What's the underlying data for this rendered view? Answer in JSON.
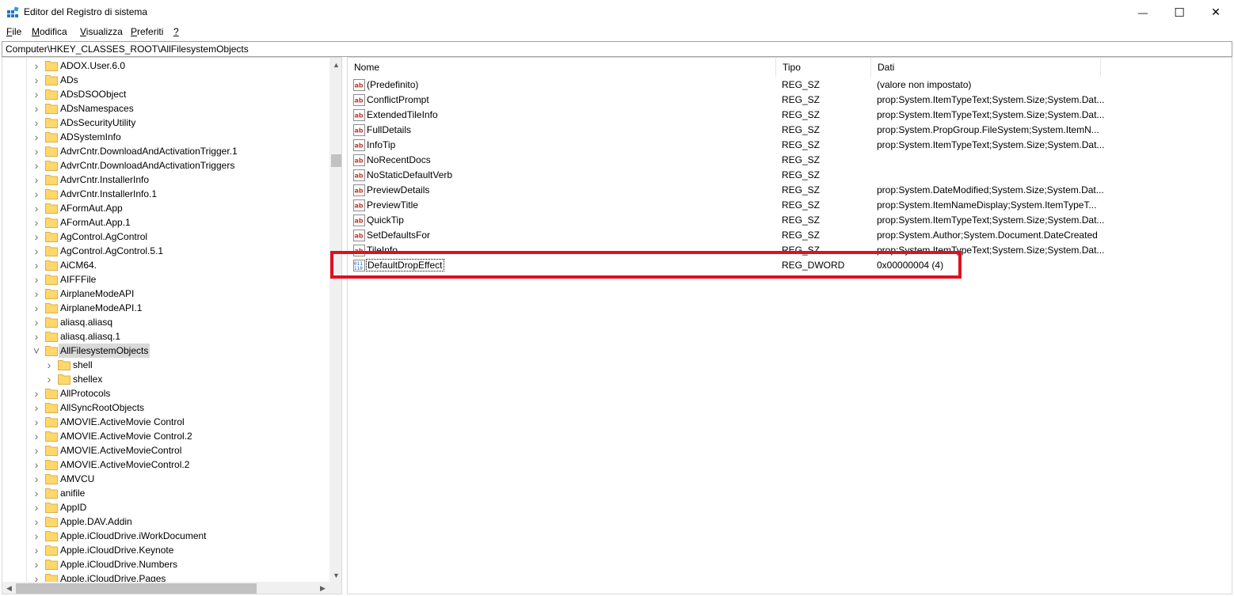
{
  "window": {
    "title": "Editor del Registro di sistema",
    "minimize_glyph": "—",
    "maximize_glyph": "☐",
    "close_glyph": "✕"
  },
  "menu": [
    {
      "label": "File",
      "underline_index": 0
    },
    {
      "label": "Modifica",
      "underline_index": 0
    },
    {
      "label": "Visualizza",
      "underline_index": 0
    },
    {
      "label": "Preferiti",
      "underline_index": 0
    },
    {
      "label": "?",
      "underline_index": 0
    }
  ],
  "address": "Computer\\HKEY_CLASSES_ROOT\\AllFilesystemObjects",
  "tree": {
    "items": [
      {
        "label": "ADOX.User.6.0",
        "level": 0,
        "expanded": false
      },
      {
        "label": "ADs",
        "level": 0,
        "expanded": false
      },
      {
        "label": "ADsDSOObject",
        "level": 0,
        "expanded": false
      },
      {
        "label": "ADsNamespaces",
        "level": 0,
        "expanded": false
      },
      {
        "label": "ADsSecurityUtility",
        "level": 0,
        "expanded": false
      },
      {
        "label": "ADSystemInfo",
        "level": 0,
        "expanded": false
      },
      {
        "label": "AdvrCntr.DownloadAndActivationTrigger.1",
        "level": 0,
        "expanded": false
      },
      {
        "label": "AdvrCntr.DownloadAndActivationTriggers",
        "level": 0,
        "expanded": false
      },
      {
        "label": "AdvrCntr.InstallerInfo",
        "level": 0,
        "expanded": false
      },
      {
        "label": "AdvrCntr.InstallerInfo.1",
        "level": 0,
        "expanded": false
      },
      {
        "label": "AFormAut.App",
        "level": 0,
        "expanded": false
      },
      {
        "label": "AFormAut.App.1",
        "level": 0,
        "expanded": false
      },
      {
        "label": "AgControl.AgControl",
        "level": 0,
        "expanded": false
      },
      {
        "label": "AgControl.AgControl.5.1",
        "level": 0,
        "expanded": false
      },
      {
        "label": "AiCM64.",
        "level": 0,
        "expanded": false
      },
      {
        "label": "AIFFFile",
        "level": 0,
        "expanded": false
      },
      {
        "label": "AirplaneModeAPI",
        "level": 0,
        "expanded": false
      },
      {
        "label": "AirplaneModeAPI.1",
        "level": 0,
        "expanded": false
      },
      {
        "label": "aliasq.aliasq",
        "level": 0,
        "expanded": false
      },
      {
        "label": "aliasq.aliasq.1",
        "level": 0,
        "expanded": false
      },
      {
        "label": "AllFilesystemObjects",
        "level": 0,
        "expanded": true,
        "selected": true
      },
      {
        "label": "shell",
        "level": 1,
        "expanded": false
      },
      {
        "label": "shellex",
        "level": 1,
        "expanded": false
      },
      {
        "label": "AllProtocols",
        "level": 0,
        "expanded": false
      },
      {
        "label": "AllSyncRootObjects",
        "level": 0,
        "expanded": false
      },
      {
        "label": "AMOVIE.ActiveMovie Control",
        "level": 0,
        "expanded": false
      },
      {
        "label": "AMOVIE.ActiveMovie Control.2",
        "level": 0,
        "expanded": false
      },
      {
        "label": "AMOVIE.ActiveMovieControl",
        "level": 0,
        "expanded": false
      },
      {
        "label": "AMOVIE.ActiveMovieControl.2",
        "level": 0,
        "expanded": false
      },
      {
        "label": "AMVCU",
        "level": 0,
        "expanded": false
      },
      {
        "label": "anifile",
        "level": 0,
        "expanded": false
      },
      {
        "label": "AppID",
        "level": 0,
        "expanded": false
      },
      {
        "label": "Apple.DAV.Addin",
        "level": 0,
        "expanded": false
      },
      {
        "label": "Apple.iCloudDrive.iWorkDocument",
        "level": 0,
        "expanded": false
      },
      {
        "label": "Apple.iCloudDrive.Keynote",
        "level": 0,
        "expanded": false
      },
      {
        "label": "Apple.iCloudDrive.Numbers",
        "level": 0,
        "expanded": false
      },
      {
        "label": "Apple.iCloudDrive.Pages",
        "level": 0,
        "expanded": false
      }
    ]
  },
  "list": {
    "columns": [
      "Nome",
      "Tipo",
      "Dati"
    ],
    "rows": [
      {
        "name": "(Predefinito)",
        "type": "REG_SZ",
        "data": "(valore non impostato)",
        "icon": "string-value-icon"
      },
      {
        "name": "ConflictPrompt",
        "type": "REG_SZ",
        "data": "prop:System.ItemTypeText;System.Size;System.Dat...",
        "icon": "string-value-icon"
      },
      {
        "name": "ExtendedTileInfo",
        "type": "REG_SZ",
        "data": "prop:System.ItemTypeText;System.Size;System.Dat...",
        "icon": "string-value-icon"
      },
      {
        "name": "FullDetails",
        "type": "REG_SZ",
        "data": "prop:System.PropGroup.FileSystem;System.ItemN...",
        "icon": "string-value-icon"
      },
      {
        "name": "InfoTip",
        "type": "REG_SZ",
        "data": "prop:System.ItemTypeText;System.Size;System.Dat...",
        "icon": "string-value-icon"
      },
      {
        "name": "NoRecentDocs",
        "type": "REG_SZ",
        "data": "",
        "icon": "string-value-icon"
      },
      {
        "name": "NoStaticDefaultVerb",
        "type": "REG_SZ",
        "data": "",
        "icon": "string-value-icon"
      },
      {
        "name": "PreviewDetails",
        "type": "REG_SZ",
        "data": "prop:System.DateModified;System.Size;System.Dat...",
        "icon": "string-value-icon"
      },
      {
        "name": "PreviewTitle",
        "type": "REG_SZ",
        "data": "prop:System.ItemNameDisplay;System.ItemTypeT...",
        "icon": "string-value-icon"
      },
      {
        "name": "QuickTip",
        "type": "REG_SZ",
        "data": "prop:System.ItemTypeText;System.Size;System.Dat...",
        "icon": "string-value-icon"
      },
      {
        "name": "SetDefaultsFor",
        "type": "REG_SZ",
        "data": "prop:System.Author;System.Document.DateCreated",
        "icon": "string-value-icon"
      },
      {
        "name": "TileInfo",
        "type": "REG_SZ",
        "data": "prop:System.ItemTypeText;System.Size;System.Dat...",
        "icon": "string-value-icon"
      },
      {
        "name": "DefaultDropEffect",
        "type": "REG_DWORD",
        "data": "0x00000004 (4)",
        "icon": "dword-value-icon",
        "focused": true
      }
    ]
  },
  "colors": {
    "highlight_border": "#e0101e",
    "folder_fill": "#ffd76b",
    "folder_edge": "#dcb04a",
    "selected_bg": "#d9d9d9"
  }
}
